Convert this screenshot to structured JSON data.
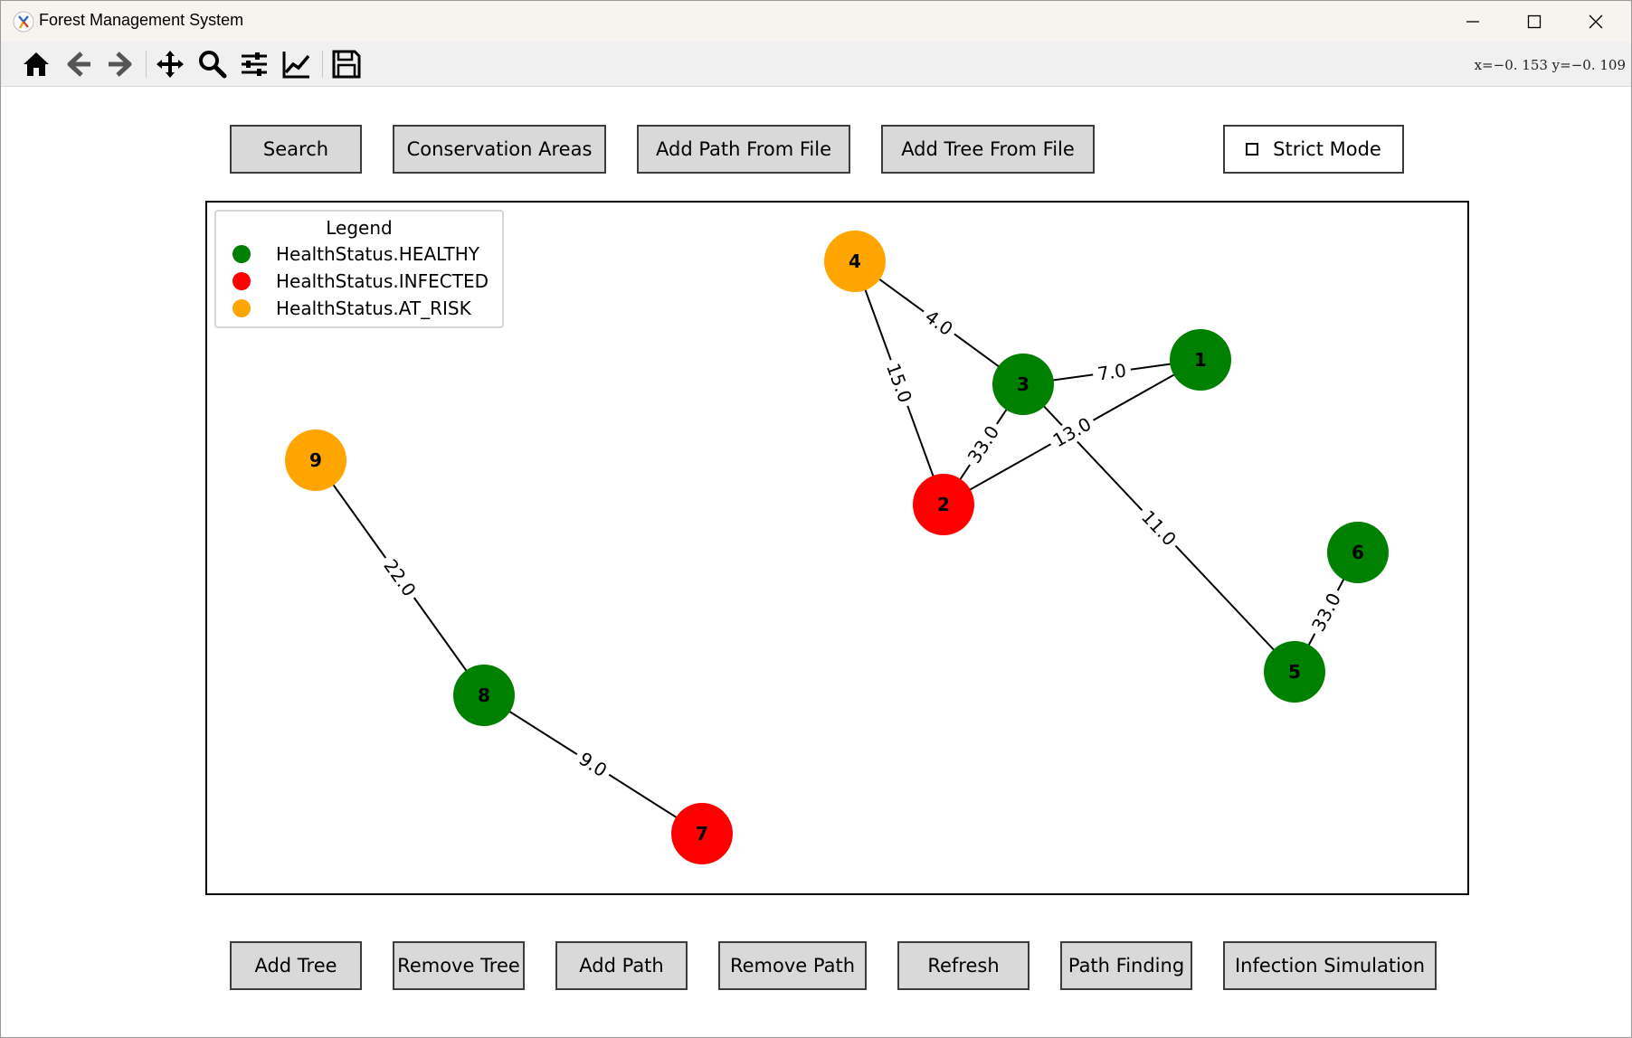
{
  "window": {
    "title": "Forest Management System"
  },
  "toolbar": {
    "tools": [
      "home-icon",
      "back-arrow-icon",
      "forward-arrow-icon",
      "pan-icon",
      "zoom-icon",
      "configure-subplots-icon",
      "edit-axis-icon",
      "save-icon"
    ],
    "coords": "x=−0. 153  y=−0. 109"
  },
  "top_buttons": {
    "search": "Search",
    "conservation": "Conservation Areas",
    "add_path_file": "Add Path From File",
    "add_tree_file": "Add Tree From File",
    "strict_mode": "Strict Mode"
  },
  "bottom_buttons": {
    "add_tree": "Add Tree",
    "remove_tree": "Remove Tree",
    "add_path": "Add Path",
    "remove_path": "Remove Path",
    "refresh": "Refresh",
    "path_finding": "Path Finding",
    "infection_sim": "Infection Simulation"
  },
  "legend": {
    "title": "Legend",
    "items": [
      {
        "label": "HealthStatus.HEALTHY",
        "color": "#008000"
      },
      {
        "label": "HealthStatus.INFECTED",
        "color": "#ff0000"
      },
      {
        "label": "HealthStatus.AT_RISK",
        "color": "#ffa500"
      }
    ]
  },
  "graph": {
    "colors": {
      "HEALTHY": "#008000",
      "INFECTED": "#ff0000",
      "AT_RISK": "#ffa500"
    },
    "nodes": [
      {
        "id": "1",
        "status": "HEALTHY"
      },
      {
        "id": "2",
        "status": "INFECTED"
      },
      {
        "id": "3",
        "status": "HEALTHY"
      },
      {
        "id": "4",
        "status": "AT_RISK"
      },
      {
        "id": "5",
        "status": "HEALTHY"
      },
      {
        "id": "6",
        "status": "HEALTHY"
      },
      {
        "id": "7",
        "status": "INFECTED"
      },
      {
        "id": "8",
        "status": "HEALTHY"
      },
      {
        "id": "9",
        "status": "AT_RISK"
      }
    ],
    "edges": [
      {
        "from": "4",
        "to": "3",
        "weight": "4.0"
      },
      {
        "from": "3",
        "to": "1",
        "weight": "7.0"
      },
      {
        "from": "4",
        "to": "2",
        "weight": "15.0"
      },
      {
        "from": "3",
        "to": "2",
        "weight": "33.0"
      },
      {
        "from": "2",
        "to": "1",
        "weight": "13.0"
      },
      {
        "from": "3",
        "to": "5",
        "weight": "11.0"
      },
      {
        "from": "6",
        "to": "5",
        "weight": "33.0"
      },
      {
        "from": "9",
        "to": "8",
        "weight": "22.0"
      },
      {
        "from": "8",
        "to": "7",
        "weight": "9.0"
      }
    ]
  }
}
